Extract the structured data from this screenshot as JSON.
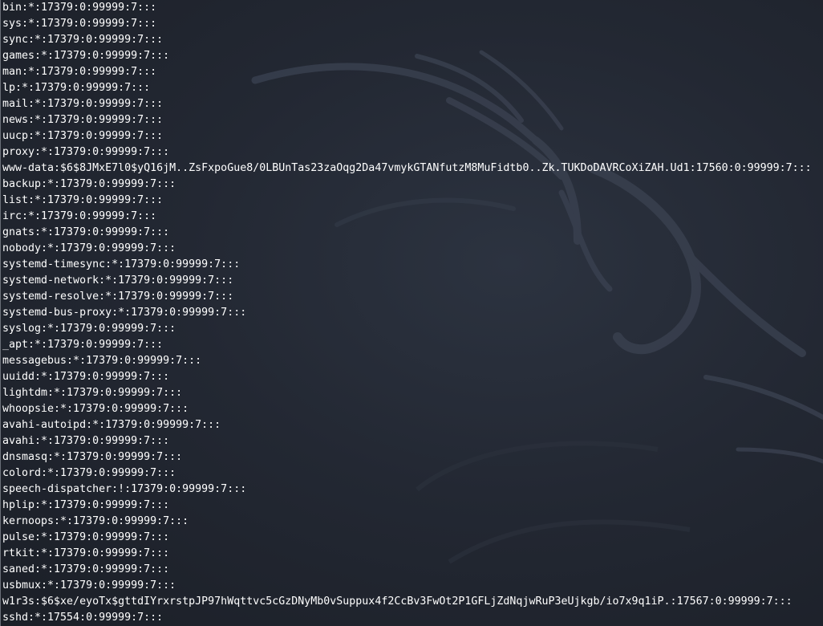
{
  "terminal": {
    "lines": [
      "bin:*:17379:0:99999:7:::",
      "sys:*:17379:0:99999:7:::",
      "sync:*:17379:0:99999:7:::",
      "games:*:17379:0:99999:7:::",
      "man:*:17379:0:99999:7:::",
      "lp:*:17379:0:99999:7:::",
      "mail:*:17379:0:99999:7:::",
      "news:*:17379:0:99999:7:::",
      "uucp:*:17379:0:99999:7:::",
      "proxy:*:17379:0:99999:7:::",
      "www-data:$6$8JMxE7l0$yQ16jM..ZsFxpoGue8/0LBUnTas23zaOqg2Da47vmykGTANfutzM8MuFidtb0..Zk.TUKDoDAVRCoXiZAH.Ud1:17560:0:99999:7:::",
      "backup:*:17379:0:99999:7:::",
      "list:*:17379:0:99999:7:::",
      "irc:*:17379:0:99999:7:::",
      "gnats:*:17379:0:99999:7:::",
      "nobody:*:17379:0:99999:7:::",
      "systemd-timesync:*:17379:0:99999:7:::",
      "systemd-network:*:17379:0:99999:7:::",
      "systemd-resolve:*:17379:0:99999:7:::",
      "systemd-bus-proxy:*:17379:0:99999:7:::",
      "syslog:*:17379:0:99999:7:::",
      "_apt:*:17379:0:99999:7:::",
      "messagebus:*:17379:0:99999:7:::",
      "uuidd:*:17379:0:99999:7:::",
      "lightdm:*:17379:0:99999:7:::",
      "whoopsie:*:17379:0:99999:7:::",
      "avahi-autoipd:*:17379:0:99999:7:::",
      "avahi:*:17379:0:99999:7:::",
      "dnsmasq:*:17379:0:99999:7:::",
      "colord:*:17379:0:99999:7:::",
      "speech-dispatcher:!:17379:0:99999:7:::",
      "hplip:*:17379:0:99999:7:::",
      "kernoops:*:17379:0:99999:7:::",
      "pulse:*:17379:0:99999:7:::",
      "rtkit:*:17379:0:99999:7:::",
      "saned:*:17379:0:99999:7:::",
      "usbmux:*:17379:0:99999:7:::",
      "w1r3s:$6$xe/eyoTx$gttdIYrxrstpJP97hWqttvc5cGzDNyMb0vSuppux4f2CcBv3FwOt2P1GFLjZdNqjwRuP3eUjkgb/io7x9q1iP.:17567:0:99999:7:::",
      "sshd:*:17554:0:99999:7:::"
    ]
  },
  "colors": {
    "background": "#232833",
    "text": "#ffffff",
    "wallpaper_mark": "#353c48"
  },
  "icons": {
    "wallpaper": "kali-dragon-icon"
  }
}
